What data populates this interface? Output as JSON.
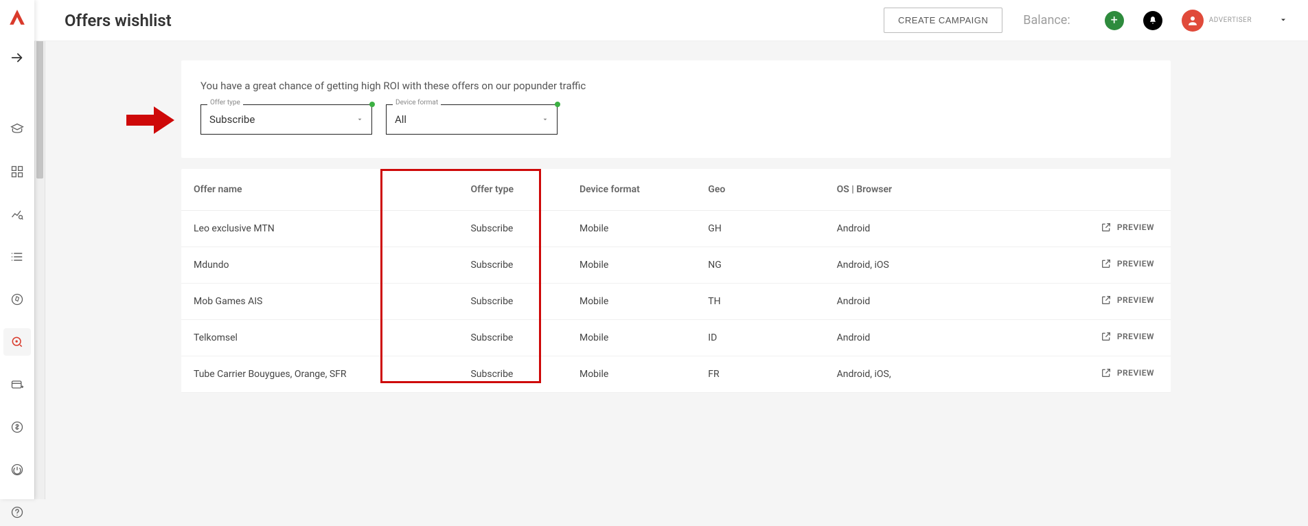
{
  "header": {
    "title": "Offers wishlist",
    "create_campaign_label": "CREATE CAMPAIGN",
    "balance_label": "Balance:",
    "role_label": "ADVERTISER"
  },
  "panel": {
    "hint": "You have a great chance of getting high ROI with these offers on our popunder traffic",
    "filter_offer_type": {
      "legend": "Offer type",
      "value": "Subscribe"
    },
    "filter_device_format": {
      "legend": "Device format",
      "value": "All"
    }
  },
  "table": {
    "columns": {
      "name": "Offer name",
      "type": "Offer type",
      "device": "Device format",
      "geo": "Geo",
      "os": "OS | Browser"
    },
    "preview_label": "PREVIEW",
    "rows": [
      {
        "name": "Leo exclusive MTN",
        "type": "Subscribe",
        "device": "Mobile",
        "geo": "GH",
        "os": "Android"
      },
      {
        "name": "Mdundo",
        "type": "Subscribe",
        "device": "Mobile",
        "geo": "NG",
        "os": "Android, iOS"
      },
      {
        "name": "Mob Games AIS",
        "type": "Subscribe",
        "device": "Mobile",
        "geo": "TH",
        "os": "Android"
      },
      {
        "name": "Telkomsel",
        "type": "Subscribe",
        "device": "Mobile",
        "geo": "ID",
        "os": "Android"
      },
      {
        "name": "Tube Carrier Bouygues, Orange, SFR",
        "type": "Subscribe",
        "device": "Mobile",
        "geo": "FR",
        "os": "Android, iOS,"
      }
    ]
  }
}
